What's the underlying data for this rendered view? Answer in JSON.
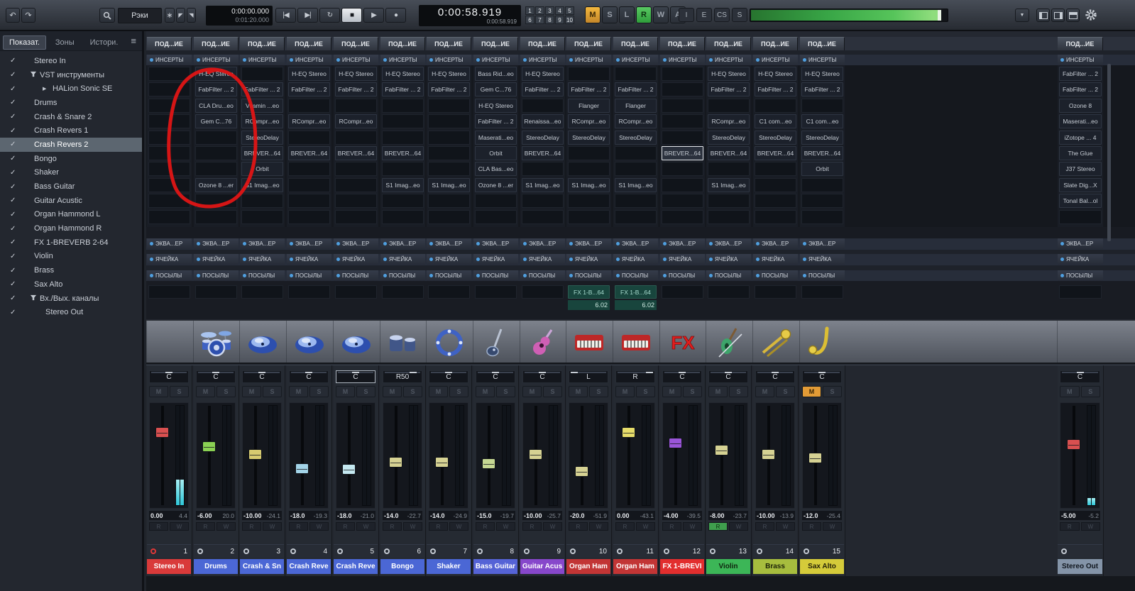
{
  "icons": {
    "undo": "↶",
    "redo": "↷",
    "menu": "≡",
    "dropdown": "▼",
    "asterisk": "∗",
    "corner_a": "◤",
    "corner_b": "◥",
    "check": "✓",
    "folder_marker": "▼",
    "child_marker": "▶",
    "search": "magnifier",
    "gear": "gear"
  },
  "colors": {
    "accent_blue": "#4f9fdf",
    "meter_cyan": "#3fd6e4",
    "meter_green": "#46b14d",
    "annotation_red": "#e01515"
  },
  "toolbar": {
    "racks_label": "Рэки",
    "locator_left": "0:00:00.000",
    "locator_right": "0:01:20.000",
    "transport": [
      "prev",
      "next",
      "cycle",
      "stop",
      "play",
      "record"
    ],
    "transport_active": "stop",
    "time_primary": "0:00:58.919",
    "time_secondary": "0:00:58.919",
    "track_buttons": [
      "1",
      "2",
      "3",
      "4",
      "5",
      "6",
      "7",
      "8",
      "9",
      "10"
    ],
    "state_buttons": [
      {
        "label": "M",
        "state": "orange"
      },
      {
        "label": "S",
        "state": "off"
      },
      {
        "label": "L",
        "state": "off"
      },
      {
        "label": "R",
        "state": "green"
      },
      {
        "label": "W",
        "state": "off"
      },
      {
        "label": "A",
        "state": "off"
      }
    ],
    "mode_buttons": [
      "I",
      "E",
      "CS",
      "S"
    ]
  },
  "sidebar": {
    "tabs": [
      "Показат.",
      "Зоны",
      "Истори."
    ],
    "active_tab": "Показат.",
    "items": [
      {
        "label": "Stereo In",
        "checked": true
      },
      {
        "label": "VST инструменты",
        "checked": true,
        "icon": "funnel"
      },
      {
        "label": "HALion Sonic SE",
        "checked": true,
        "icon": "arrow",
        "indent": 1
      },
      {
        "label": "Drums",
        "checked": true
      },
      {
        "label": "Crash & Snare 2",
        "checked": true
      },
      {
        "label": "Crash Revers 1",
        "checked": true
      },
      {
        "label": "Crash Revers 2",
        "checked": true,
        "selected": true
      },
      {
        "label": "Bongo",
        "checked": true
      },
      {
        "label": "Shaker",
        "checked": true
      },
      {
        "label": "Bass Guitar",
        "checked": true
      },
      {
        "label": "Guitar Acustic",
        "checked": true
      },
      {
        "label": "Organ Hammond L",
        "checked": true
      },
      {
        "label": "Organ Hammond R",
        "checked": true
      },
      {
        "label": "FX 1-BREVERB 2-64",
        "checked": true
      },
      {
        "label": "Violin",
        "checked": true
      },
      {
        "label": "Brass",
        "checked": true
      },
      {
        "label": "Sax Alto",
        "checked": true
      },
      {
        "label": "Вх./Вых. каналы",
        "checked": true,
        "icon": "funnel"
      },
      {
        "label": "Stereo Out",
        "checked": true,
        "indent": 2
      }
    ]
  },
  "rack": {
    "routing_label": "ПОД...ИЕ",
    "sections": {
      "inserts": "ИНСЕРТЫ",
      "eq": "ЭКВА...ЕР",
      "strip": "ЯЧЕЙКА",
      "sends": "ПОСЫЛЫ"
    },
    "columns": [
      {
        "track": "Stereo In",
        "inserts": [
          "",
          "",
          "",
          "",
          "",
          "",
          "",
          "",
          "",
          ""
        ],
        "send": "",
        "send_value": ""
      },
      {
        "track": "Drums",
        "inserts": [
          "H-EQ Stereo",
          "FabFilter ... 2",
          "CLA Dru...eo",
          "Gem C...76",
          "",
          "",
          "",
          "Ozone 8 ...er",
          "",
          ""
        ],
        "send": "",
        "send_value": ""
      },
      {
        "track": "Crash & Snare 2",
        "inserts": [
          "",
          "FabFilter ... 2",
          "Vitamin ...eo",
          "RCompr...eo",
          "StereoDelay",
          "BREVER...64",
          "Orbit",
          "S1 Imag...eo",
          "",
          ""
        ],
        "send": "",
        "send_value": ""
      },
      {
        "track": "Crash Revers 1",
        "inserts": [
          "H-EQ Stereo",
          "FabFilter ... 2",
          "",
          "RCompr...eo",
          "",
          "BREVER...64",
          "",
          "",
          "",
          ""
        ],
        "send": "",
        "send_value": ""
      },
      {
        "track": "Crash Revers 2",
        "inserts": [
          "H-EQ Stereo",
          "FabFilter ... 2",
          "",
          "RCompr...eo",
          "",
          "BREVER...64",
          "",
          "",
          "",
          ""
        ],
        "send": "",
        "send_value": ""
      },
      {
        "track": "Bongo",
        "inserts": [
          "H-EQ Stereo",
          "FabFilter ... 2",
          "",
          "",
          "",
          "BREVER...64",
          "",
          "S1 Imag...eo",
          "",
          ""
        ],
        "send": "",
        "send_value": ""
      },
      {
        "track": "Shaker",
        "inserts": [
          "H-EQ Stereo",
          "FabFilter ... 2",
          "",
          "",
          "",
          "",
          "",
          "S1 Imag...eo",
          "",
          ""
        ],
        "send": "",
        "send_value": ""
      },
      {
        "track": "Bass Guitar",
        "inserts": [
          "Bass Rid...eo",
          "Gem C...76",
          "H-EQ Stereo",
          "FabFilter ... 2",
          "Maserati...eo",
          "Orbit",
          "CLA Bas...eo",
          "Ozone 8 ...er",
          "",
          ""
        ],
        "send": "",
        "send_value": ""
      },
      {
        "track": "Guitar Acustic",
        "inserts": [
          "H-EQ Stereo",
          "FabFilter ... 2",
          "",
          "Renaissa...eo",
          "StereoDelay",
          "BREVER...64",
          "",
          "S1 Imag...eo",
          "",
          ""
        ],
        "send": "",
        "send_value": ""
      },
      {
        "track": "Organ Hammond L",
        "inserts": [
          "",
          "FabFilter ... 2",
          "Flanger",
          "RCompr...eo",
          "StereoDelay",
          "",
          "",
          "S1 Imag...eo",
          "",
          ""
        ],
        "send": "FX 1-B...64",
        "send_value": "6.02"
      },
      {
        "track": "Organ Hammond R",
        "inserts": [
          "",
          "FabFilter ... 2",
          "Flanger",
          "RCompr...eo",
          "StereoDelay",
          "",
          "",
          "S1 Imag...eo",
          "",
          ""
        ],
        "send": "FX 1-B...64",
        "send_value": "6.02"
      },
      {
        "track": "FX 1-BREVERB 2-64",
        "inserts": [
          "",
          "",
          "",
          "",
          "",
          "BREVER...64",
          "",
          "",
          "",
          ""
        ],
        "send": "",
        "send_value": "",
        "selected_insert": 5
      },
      {
        "track": "Violin",
        "inserts": [
          "H-EQ Stereo",
          "FabFilter ... 2",
          "",
          "RCompr...eo",
          "StereoDelay",
          "BREVER...64",
          "",
          "S1 Imag...eo",
          "",
          ""
        ],
        "send": "",
        "send_value": ""
      },
      {
        "track": "Brass",
        "inserts": [
          "H-EQ Stereo",
          "FabFilter ... 2",
          "",
          "C1 com...eo",
          "StereoDelay",
          "BREVER...64",
          "",
          "",
          "",
          ""
        ],
        "send": "",
        "send_value": ""
      },
      {
        "track": "Sax Alto",
        "inserts": [
          "H-EQ Stereo",
          "FabFilter ... 2",
          "",
          "C1 com...eo",
          "StereoDelay",
          "BREVER...64",
          "Orbit",
          "",
          "",
          ""
        ],
        "send": "",
        "send_value": ""
      },
      {
        "track": "Stereo Out",
        "inserts": [
          "FabFilter ... 2",
          "FabFilter ... 2",
          "Ozone 8",
          "Maserati...eo",
          "iZotope ... 4",
          "The Glue",
          "J37 Stereo",
          "Slate Dig...X",
          "Tonal Bal...ol",
          ""
        ],
        "send": "",
        "send_value": ""
      }
    ]
  },
  "instruments": [
    "",
    "drumkit",
    "cymbal",
    "cymbal",
    "cymbal",
    "bongos",
    "tambourine",
    "bass",
    "guitar",
    "organ",
    "organ",
    "fx",
    "violin",
    "trombone",
    "sax",
    ""
  ],
  "faders": {
    "labels": {
      "mute": "M",
      "solo": "S",
      "read": "R",
      "write": "W"
    },
    "strips": [
      {
        "pan": "C",
        "db": "0.00",
        "peak": "4.4",
        "num": "1",
        "name": "Stereo In",
        "name_bg": "#d93a3a",
        "name_fg": "#ffffff",
        "cap": "#d85050",
        "pos": 25,
        "meter": 26,
        "icon_red": true
      },
      {
        "pan": "C",
        "db": "-6.00",
        "peak": "20.0",
        "num": "2",
        "name": "Drums",
        "name_bg": "#4b67d5",
        "name_fg": "#ffffff",
        "cap": "#8ad153",
        "pos": 40,
        "meter": 0
      },
      {
        "pan": "C",
        "db": "-10.00",
        "peak": "-24.1",
        "num": "3",
        "name": "Crash & Sn",
        "name_bg": "#4b67d5",
        "name_fg": "#ffffff",
        "cap": "#d6ca70",
        "pos": 48,
        "meter": 0
      },
      {
        "pan": "C",
        "db": "-18.0",
        "peak": "-19.3",
        "num": "4",
        "name": "Crash Reve",
        "name_bg": "#4b67d5",
        "name_fg": "#ffffff",
        "cap": "#a3d4e8",
        "pos": 63,
        "meter": 0
      },
      {
        "pan": "C",
        "pan_selected": true,
        "db": "-18.0",
        "peak": "-21.0",
        "num": "5",
        "name": "Crash Reve",
        "name_bg": "#4b67d5",
        "name_fg": "#ffffff",
        "cap": "#c4e8f0",
        "pos": 64,
        "meter": 0
      },
      {
        "pan": "R50",
        "db": "-14.0",
        "peak": "-22.7",
        "num": "6",
        "name": "Bongo",
        "name_bg": "#4b67d5",
        "name_fg": "#ffffff",
        "cap": "#d6d293",
        "pos": 56,
        "meter": 0
      },
      {
        "pan": "C",
        "db": "-14.0",
        "peak": "-24.9",
        "num": "7",
        "name": "Shaker",
        "name_bg": "#4b67d5",
        "name_fg": "#ffffff",
        "cap": "#d6d293",
        "pos": 56,
        "meter": 0
      },
      {
        "pan": "C",
        "db": "-15.0",
        "peak": "-19.7",
        "num": "8",
        "name": "Bass Guitar",
        "name_bg": "#5563d6",
        "name_fg": "#ffffff",
        "cap": "#c6d893",
        "pos": 58,
        "meter": 0
      },
      {
        "pan": "C",
        "db": "-10.00",
        "peak": "-25.7",
        "num": "9",
        "name": "Guitar Acus",
        "name_bg": "#8747cb",
        "name_fg": "#ffffff",
        "cap": "#d6d293",
        "pos": 48,
        "meter": 0
      },
      {
        "pan": "L",
        "db": "-20.0",
        "peak": "-51.9",
        "num": "10",
        "name": "Organ Ham",
        "name_bg": "#c23535",
        "name_fg": "#ffffff",
        "cap": "#d6d293",
        "pos": 66,
        "meter": 0
      },
      {
        "pan": "R",
        "db": "0.00",
        "peak": "-43.1",
        "num": "11",
        "name": "Organ Ham",
        "name_bg": "#c23535",
        "name_fg": "#ffffff",
        "cap": "#e6dc6a",
        "pos": 25,
        "meter": 0
      },
      {
        "pan": "C",
        "db": "-4.00",
        "peak": "-39.5",
        "num": "12",
        "name": "FX 1-BREVI",
        "name_bg": "#e22e2e",
        "name_fg": "#ffffff",
        "cap": "#9a55d8",
        "pos": 36,
        "meter": 0
      },
      {
        "pan": "C",
        "db": "-8.00",
        "peak": "-23.7",
        "num": "13",
        "name": "Violin",
        "name_bg": "#3cb657",
        "name_fg": "#10240f",
        "cap": "#d6d293",
        "pos": 44,
        "meter": 0,
        "r_active": true
      },
      {
        "pan": "C",
        "db": "-10.00",
        "peak": "-13.9",
        "num": "14",
        "name": "Brass",
        "name_bg": "#a7bd3e",
        "name_fg": "#1c2208",
        "cap": "#d6d293",
        "pos": 48,
        "meter": 0
      },
      {
        "pan": "C",
        "db": "-12.0",
        "peak": "-25.4",
        "num": "15",
        "name": "Sax Alto",
        "name_bg": "#d5cb3a",
        "name_fg": "#262208",
        "cap": "#d6d293",
        "pos": 52,
        "meter": 0,
        "m_active": true
      },
      {
        "pan": "C",
        "db": "-5.00",
        "peak": "-5.2",
        "num": "",
        "name": "Stereo Out",
        "name_bg": "#8494a8",
        "name_fg": "#10161e",
        "cap": "#d85050",
        "pos": 38,
        "meter": 7
      }
    ]
  },
  "annotation": {
    "shape": "hand-drawn-circle",
    "color": "#e01515",
    "target": "drums-insert-chain"
  }
}
